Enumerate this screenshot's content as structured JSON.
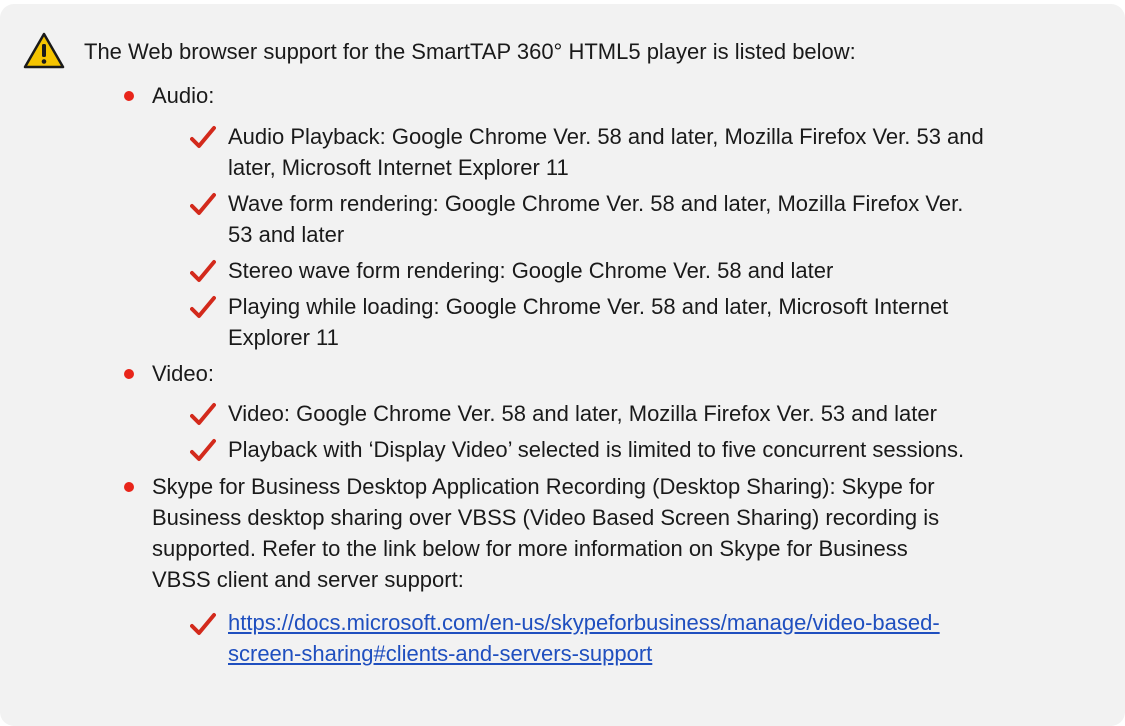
{
  "intro": "The Web browser support for the SmartTAP 360° HTML5 player is listed below:",
  "colors": {
    "background": "#f2f2f2",
    "bullet": "#e8251a",
    "checkmark": "#d32a1c",
    "link": "#1f4fbf",
    "warning_fill": "#f5c400"
  },
  "icons": {
    "warning": "warning-triangle-icon",
    "bullet": "bullet-dot-icon",
    "check": "checkmark-icon"
  },
  "sections": [
    {
      "label": "Audio:",
      "items": [
        {
          "line1": "Audio Playback: Google Chrome Ver. 58 and later, Mozilla Firefox Ver. 53 and",
          "line2": "later, Microsoft Internet Explorer 11"
        },
        {
          "line1": "Wave form rendering: Google Chrome Ver. 58 and later, Mozilla Firefox Ver.",
          "line2": "53 and later"
        },
        {
          "line1": "Stereo wave form rendering: Google Chrome Ver. 58 and later"
        },
        {
          "line1": "Playing while loading: Google Chrome Ver. 58 and later, Microsoft Internet",
          "line2": "Explorer 11"
        }
      ]
    },
    {
      "label": "Video:",
      "items": [
        {
          "line1": "Video: Google Chrome Ver. 58 and later, Mozilla Firefox Ver. 53 and later"
        },
        {
          "line1": "Playback with ‘Display Video’ selected is limited to five concurrent sessions."
        }
      ]
    },
    {
      "lines": [
        "Skype for Business Desktop Application Recording (Desktop Sharing): Skype for",
        "Business desktop sharing over VBSS (Video Based Screen Sharing) recording is",
        "supported. Refer to the link below for more information on Skype for Business",
        "VBSS client and server support:"
      ],
      "link": {
        "line1": "https://docs.microsoft.com/en-us/skypeforbusiness/manage/video-based-",
        "line2": "screen-sharing#clients-and-servers-support"
      }
    }
  ]
}
